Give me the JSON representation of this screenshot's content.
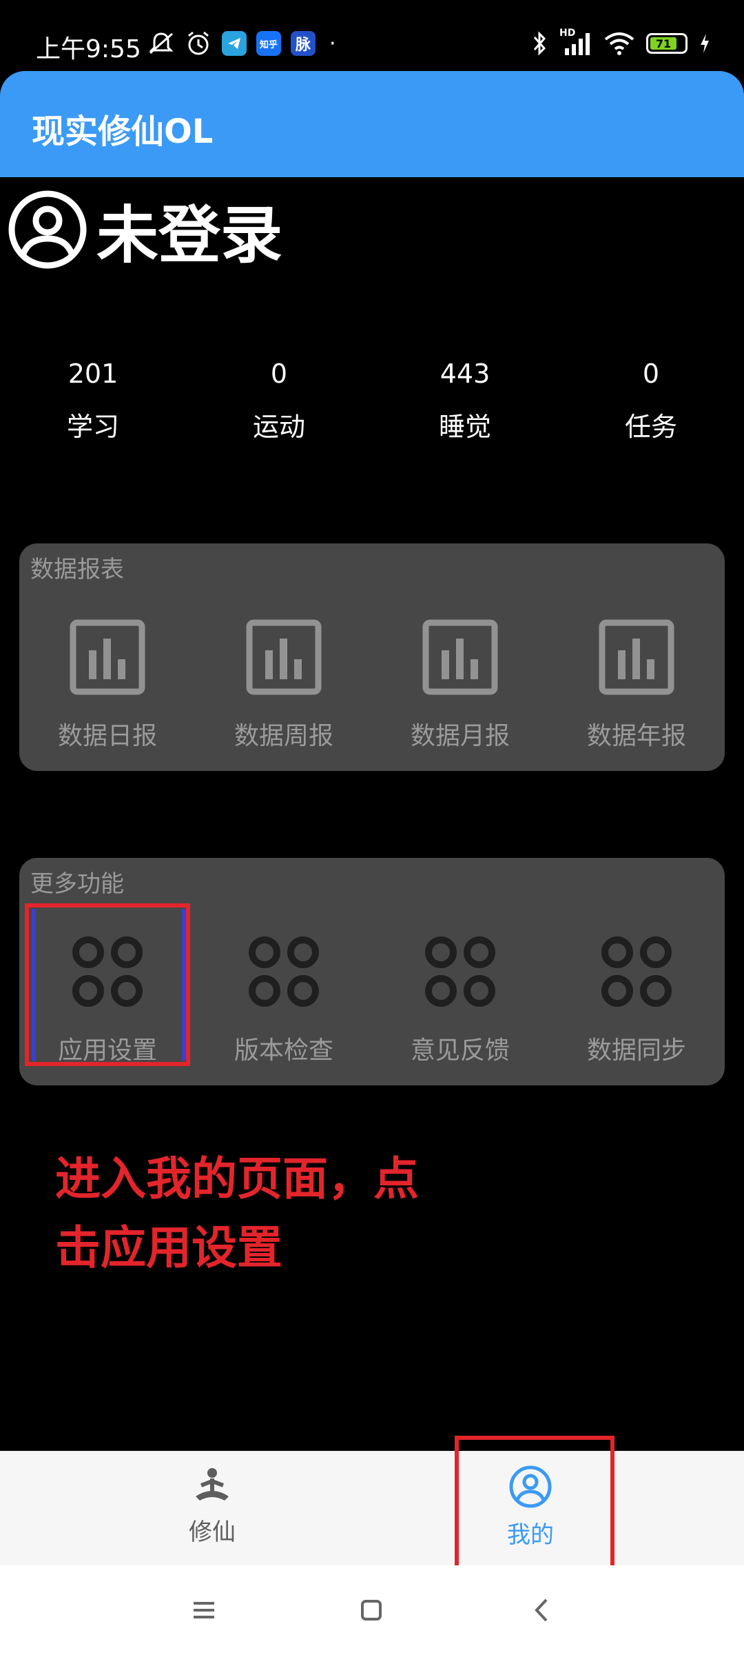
{
  "status_bar": {
    "time": "上午9:55",
    "app_icons": [
      "知乎",
      "脉"
    ],
    "battery": "71",
    "network": "HD"
  },
  "app_bar": {
    "title": "现实修仙OL"
  },
  "profile": {
    "name": "未登录"
  },
  "stats": [
    {
      "value": "201",
      "label": "学习"
    },
    {
      "value": "0",
      "label": "运动"
    },
    {
      "value": "443",
      "label": "睡觉"
    },
    {
      "value": "0",
      "label": "任务"
    }
  ],
  "reports": {
    "title": "数据报表",
    "items": [
      {
        "label": "数据日报",
        "icon": "bar-chart-icon"
      },
      {
        "label": "数据周报",
        "icon": "bar-chart-icon"
      },
      {
        "label": "数据月报",
        "icon": "bar-chart-icon"
      },
      {
        "label": "数据年报",
        "icon": "bar-chart-icon"
      }
    ]
  },
  "more": {
    "title": "更多功能",
    "items": [
      {
        "label": "应用设置",
        "icon": "grid-circles-icon"
      },
      {
        "label": "版本检查",
        "icon": "grid-circles-icon"
      },
      {
        "label": "意见反馈",
        "icon": "grid-circles-icon"
      },
      {
        "label": "数据同步",
        "icon": "grid-circles-icon"
      }
    ]
  },
  "annotation": {
    "line1": "进入我的页面，点",
    "line2": "击应用设置",
    "color": "#e3252b"
  },
  "bottom_nav": {
    "items": [
      {
        "label": "修仙",
        "icon": "meditation-icon",
        "active": false
      },
      {
        "label": "我的",
        "icon": "user-circle-icon",
        "active": true
      }
    ],
    "active_color": "#3b9af6"
  },
  "colors": {
    "app_bar": "#3b9af6",
    "card": "#474747",
    "background": "#000000"
  }
}
